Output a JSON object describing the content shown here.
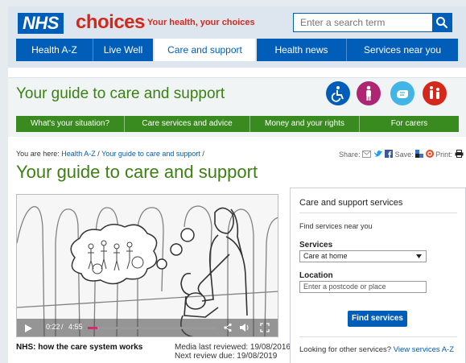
{
  "header": {
    "logo_text": "NHS",
    "brand": "choices",
    "tagline": "Your health, your choices",
    "search_placeholder": "Enter a search term"
  },
  "nav": {
    "items": [
      {
        "label": "Health A-Z"
      },
      {
        "label": "Live Well"
      },
      {
        "label": "Care and support"
      },
      {
        "label": "Health news"
      },
      {
        "label": "Services near you"
      }
    ]
  },
  "hero": {
    "title": "Your guide to care and support",
    "icons": [
      {
        "name": "wheelchair-icon",
        "color": "#005eb8"
      },
      {
        "name": "person-icon",
        "color": "#ae2573"
      },
      {
        "name": "sign-language-icon",
        "color": "#41b6e6"
      },
      {
        "name": "carer-icon",
        "color": "#d5281b"
      }
    ],
    "subnav": [
      {
        "label": "What's your situation?"
      },
      {
        "label": "Care services and advice"
      },
      {
        "label": "Money and your rights"
      },
      {
        "label": "For carers"
      }
    ]
  },
  "breadcrumb": {
    "prefix": "You are here:",
    "items": [
      "Health A-Z",
      "Your guide to care and support"
    ],
    "separator": "/"
  },
  "share": {
    "share_label": "Share:",
    "save_label": "Save:",
    "print_label": "Print:"
  },
  "page_title": "Your guide to care and support",
  "video": {
    "current_time": "0:22",
    "divider": "/",
    "duration": "4:55",
    "progress_fraction": 0.075,
    "caption": "NHS: how the care system works",
    "last_reviewed": "Media last reviewed: 19/08/2016",
    "next_review": "Next review due: 19/08/2019"
  },
  "services_panel": {
    "title": "Care and support services",
    "find_near_you": "Find services near you",
    "services_label": "Services",
    "services_selected": "Care at home",
    "location_label": "Location",
    "location_placeholder": "Enter a postcode or place",
    "find_button": "Find services",
    "other_text": "Looking for other services?",
    "other_link": "View services A-Z"
  }
}
